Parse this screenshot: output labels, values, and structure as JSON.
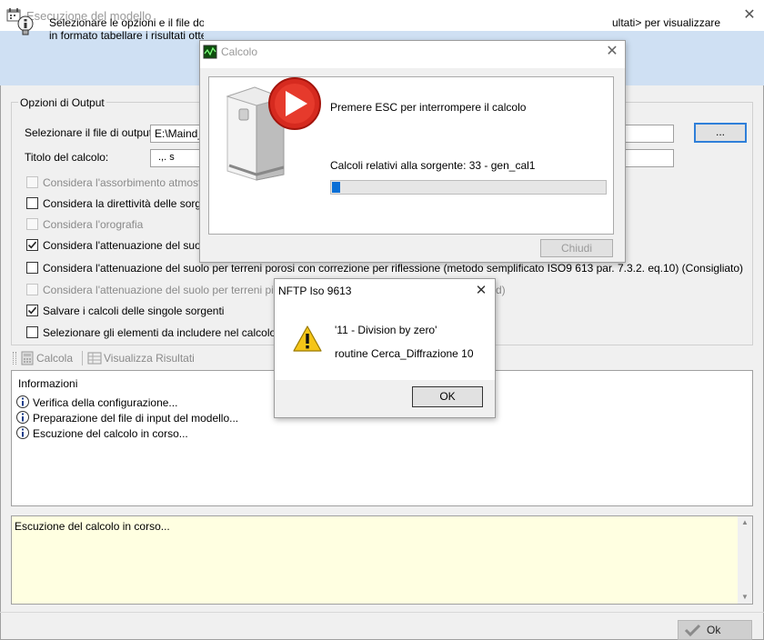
{
  "main": {
    "title": "Esecuzione del modello",
    "close_glyph": "✕",
    "banner_text_left_line1": "Selezionare le opzioni e il file dove i",
    "banner_text_left_line2": "in formato tabellare i risultati ottenuti",
    "banner_text_right": "ultati> per visualizzare"
  },
  "output_options": {
    "legend": "Opzioni di Output",
    "file_label": "Selezionare il file di output:",
    "file_value": "E:\\Maind_",
    "browse_label": "...",
    "title_label": "Titolo del calcolo:",
    "title_value": ".,.      s",
    "options": [
      {
        "label": "Considera l'assorbimento atmosferico",
        "checked": false,
        "enabled": false
      },
      {
        "label": "Considera la direttività delle sorgenti",
        "checked": false,
        "enabled": true
      },
      {
        "label": "Considera l'orografia",
        "checked": false,
        "enabled": false
      },
      {
        "label": "Considera l'attenuazione del suolo pe",
        "checked": true,
        "enabled": true
      },
      {
        "label": "Considera l'attenuazione del suolo per terreni porosi con correzione per riflessione (metodo semplificato ISO9 613 par. 7.3.2. eq.10) (Consigliato)",
        "checked": false,
        "enabled": true
      },
      {
        "label": "Considera l'attenuazione del suolo per terreni pianeggi",
        "checked": false,
        "enabled": false
      },
      {
        "label": "Salvare i calcoli delle singole sorgenti",
        "checked": true,
        "enabled": true
      },
      {
        "label": "Selezionare gli elementi da includere nel calcolo (sorge",
        "checked": false,
        "enabled": true
      }
    ],
    "option5_tail": "d)"
  },
  "toolbar": {
    "calcola_label": "Calcola",
    "visualizza_label": "Visualizza Risultati"
  },
  "log": {
    "header": "Informazioni",
    "entries": [
      "Verifica della configurazione...",
      "Preparazione del file di input del modello...",
      "Escuzione del calcolo in corso..."
    ]
  },
  "status": {
    "text": "Escuzione del calcolo in corso..."
  },
  "footer": {
    "ok_label": "Ok"
  },
  "calc_dialog": {
    "title": "Calcolo",
    "close_glyph": "✕",
    "esc_text": "Premere ESC per interrompere il calcolo",
    "source_text": "Calcoli relativi alla sorgente: 33 - gen_cal1",
    "progress": 0.03,
    "chiudi_label": "Chiudi"
  },
  "error_dialog": {
    "title": "NFTP Iso 9613",
    "close_glyph": "✕",
    "message": "'11 - Division by zero'",
    "detail": "routine Cerca_Diffrazione 10",
    "ok_label": "OK",
    "icon": "warning-icon"
  },
  "colors": {
    "banner": "#cfe0f3",
    "progress": "#0a6fd6",
    "status_bg": "#ffffe1",
    "focus_border": "#2f7fd9"
  }
}
